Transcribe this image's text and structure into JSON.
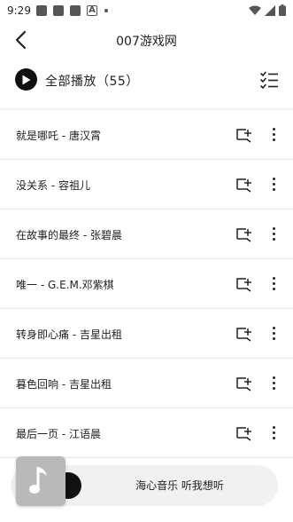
{
  "status_bar": {
    "time": "9:29",
    "notif_icons": [
      "app-icon",
      "app-icon",
      "app-icon",
      "a-icon",
      "dot-icon"
    ],
    "right_icons": [
      "wifi-icon",
      "signal-icon",
      "battery-icon"
    ]
  },
  "header": {
    "title": "007游戏网",
    "back_icon": "chevron-left-icon"
  },
  "play_all": {
    "label": "全部播放",
    "count": "（55）",
    "play_icon": "play-icon",
    "multiselect_icon": "checklist-icon"
  },
  "songs": [
    {
      "title": "就是哪吒 - 唐汉霄"
    },
    {
      "title": "没关系 - 容祖儿"
    },
    {
      "title": "在故事的最终 - 张碧晨"
    },
    {
      "title": "唯一 - G.E.M.邓紫棋"
    },
    {
      "title": "转身即心痛 - 吉星出租"
    },
    {
      "title": "暮色回响 - 吉星出租"
    },
    {
      "title": "最后一页 - 江语晨"
    }
  ],
  "mini_player": {
    "text": "海心音乐 听我想听",
    "cover_icon": "music-note-icon"
  }
}
